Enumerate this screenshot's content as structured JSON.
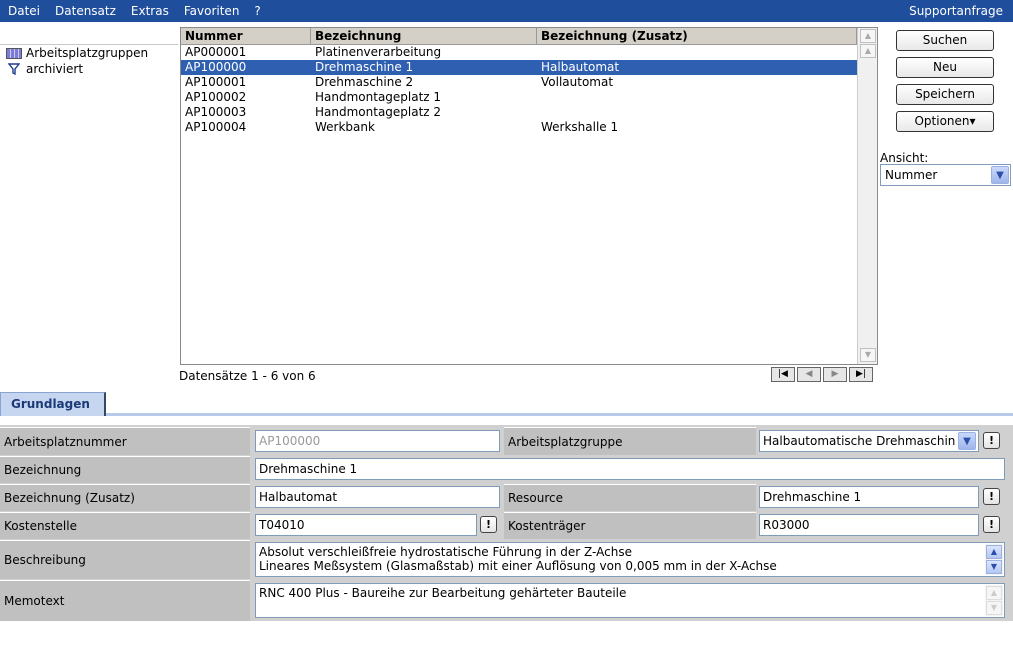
{
  "menu": {
    "items": [
      {
        "label": "Datei"
      },
      {
        "label": "Datensatz"
      },
      {
        "label": "Extras"
      },
      {
        "label": "Favoriten"
      },
      {
        "label": "?"
      }
    ],
    "support": "Supportanfrage"
  },
  "tree": {
    "items": [
      {
        "label": "Arbeitsplatzgruppen",
        "icon": "grid-icon"
      },
      {
        "label": "archiviert",
        "icon": "filter-icon"
      }
    ]
  },
  "list": {
    "columns": [
      "Nummer",
      "Bezeichnung",
      "Bezeichnung (Zusatz)"
    ],
    "rows": [
      {
        "nummer": "AP000001",
        "bezeichnung": "Platinenverarbeitung",
        "zusatz": ""
      },
      {
        "nummer": "AP100000",
        "bezeichnung": "Drehmaschine 1",
        "zusatz": "Halbautomat",
        "selected": true
      },
      {
        "nummer": "AP100001",
        "bezeichnung": "Drehmaschine 2",
        "zusatz": "Vollautomat"
      },
      {
        "nummer": "AP100002",
        "bezeichnung": "Handmontageplatz 1",
        "zusatz": ""
      },
      {
        "nummer": "AP100003",
        "bezeichnung": "Handmontageplatz 2",
        "zusatz": ""
      },
      {
        "nummer": "AP100004",
        "bezeichnung": "Werkbank",
        "zusatz": "Werkshalle 1"
      }
    ],
    "record_count": "Datensätze 1 - 6 von 6"
  },
  "actions": {
    "search": "Suchen",
    "new": "Neu",
    "save": "Speichern",
    "options": "Optionen▾"
  },
  "view": {
    "label": "Ansicht:",
    "value": "Nummer"
  },
  "tabs": {
    "active": "Grundlagen"
  },
  "form": {
    "arbeitsplatznummer_label": "Arbeitsplatznummer",
    "arbeitsplatznummer": "AP100000",
    "arbeitsplatzgruppe_label": "Arbeitsplatzgruppe",
    "arbeitsplatzgruppe": "Halbautomatische Drehmaschin",
    "bezeichnung_label": "Bezeichnung",
    "bezeichnung": "Drehmaschine 1",
    "zusatz_label": "Bezeichnung (Zusatz)",
    "zusatz": "Halbautomat",
    "resource_label": "Resource",
    "resource": "Drehmaschine 1",
    "kostenstelle_label": "Kostenstelle",
    "kostenstelle": "T04010",
    "kostentraeger_label": "Kostenträger",
    "kostentraeger": "R03000",
    "beschreibung_label": "Beschreibung",
    "beschreibung_line1": "Absolut verschleißfreie hydrostatische Führung in der Z-Achse",
    "beschreibung_line2": "Lineares Meßsystem (Glasmaßstab) mit einer Auflösung von 0,005 mm in der X-Achse",
    "memotext_label": "Memotext",
    "memotext": "RNC 400 Plus - Baureihe zur Bearbeitung gehärteter Bauteile",
    "lookup_symbol": "!"
  }
}
